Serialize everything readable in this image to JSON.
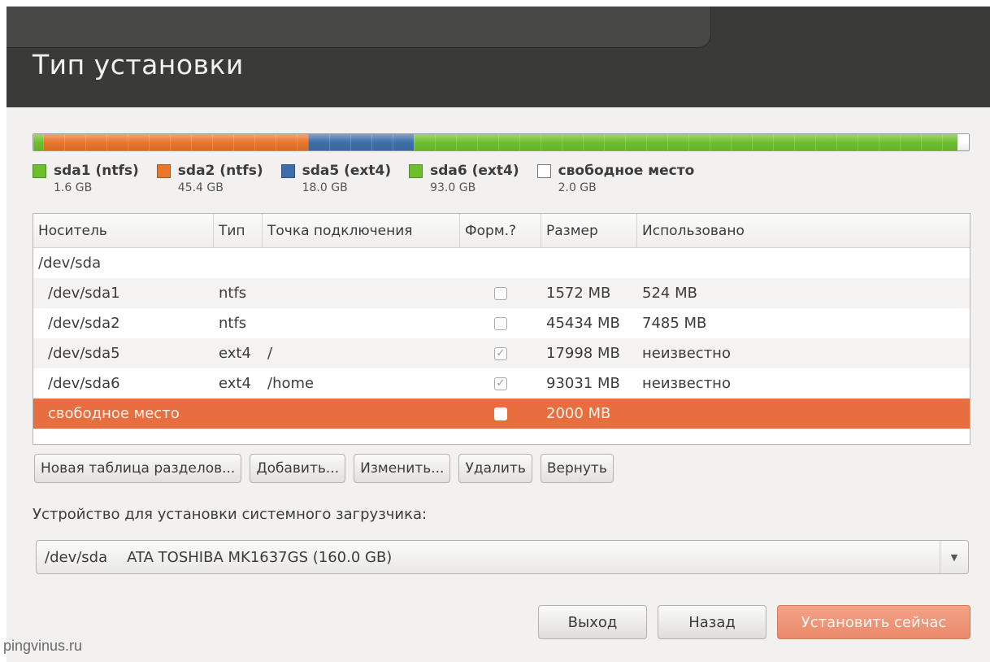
{
  "window": {
    "title": "Тип установки"
  },
  "colors": {
    "sda1": "#6dbf2e",
    "sda2": "#e8762d",
    "sda5": "#3f6fa8",
    "sda6": "#6dbf2e",
    "free": "#ffffff",
    "selected_row": "#e96e3f"
  },
  "disk_bar": [
    {
      "id": "sda1",
      "size_gb": 1.6,
      "color": "#6dbf2e"
    },
    {
      "id": "sda2",
      "size_gb": 45.4,
      "color": "#e8762d"
    },
    {
      "id": "sda5",
      "size_gb": 18.0,
      "color": "#3f6fa8"
    },
    {
      "id": "sda6",
      "size_gb": 93.0,
      "color": "#6dbf2e"
    },
    {
      "id": "free",
      "size_gb": 2.0,
      "color": "#ffffff"
    }
  ],
  "legend": [
    {
      "name": "sda1 (ntfs)",
      "size": "1.6 GB",
      "color": "#6dbf2e"
    },
    {
      "name": "sda2 (ntfs)",
      "size": "45.4 GB",
      "color": "#e8762d"
    },
    {
      "name": "sda5 (ext4)",
      "size": "18.0 GB",
      "color": "#3f6fa8"
    },
    {
      "name": "sda6 (ext4)",
      "size": "93.0 GB",
      "color": "#6dbf2e"
    },
    {
      "name": "свободное место",
      "size": "2.0 GB",
      "color": "#ffffff"
    }
  ],
  "table": {
    "headers": [
      "Носитель",
      "Тип",
      "Точка подключения",
      "Форм.?",
      "Размер",
      "Использовано"
    ],
    "device_row": "/dev/sda",
    "rows": [
      {
        "device": "/dev/sda1",
        "type": "ntfs",
        "mount": "",
        "format": false,
        "size": "1572 MB",
        "used": "524 MB"
      },
      {
        "device": "/dev/sda2",
        "type": "ntfs",
        "mount": "",
        "format": false,
        "size": "45434 MB",
        "used": "7485 MB"
      },
      {
        "device": "/dev/sda5",
        "type": "ext4",
        "mount": "/",
        "format": true,
        "size": "17998 MB",
        "used": "неизвестно"
      },
      {
        "device": "/dev/sda6",
        "type": "ext4",
        "mount": "/home",
        "format": true,
        "size": "93031 MB",
        "used": "неизвестно"
      },
      {
        "device": "свободное место",
        "type": "",
        "mount": "",
        "format": false,
        "size": "2000 MB",
        "used": "",
        "selected": true
      }
    ]
  },
  "buttons": {
    "new_table": "Новая таблица разделов...",
    "add": "Добавить...",
    "change": "Изменить...",
    "delete": "Удалить",
    "revert": "Вернуть"
  },
  "bootloader": {
    "label": "Устройство для установки системного загрузчика:",
    "device": "/dev/sda",
    "model": "ATA TOSHIBA MK1637GS (160.0 GB)"
  },
  "footer": {
    "quit": "Выход",
    "back": "Назад",
    "install": "Установить сейчас"
  },
  "watermark": "pingvinus.ru"
}
